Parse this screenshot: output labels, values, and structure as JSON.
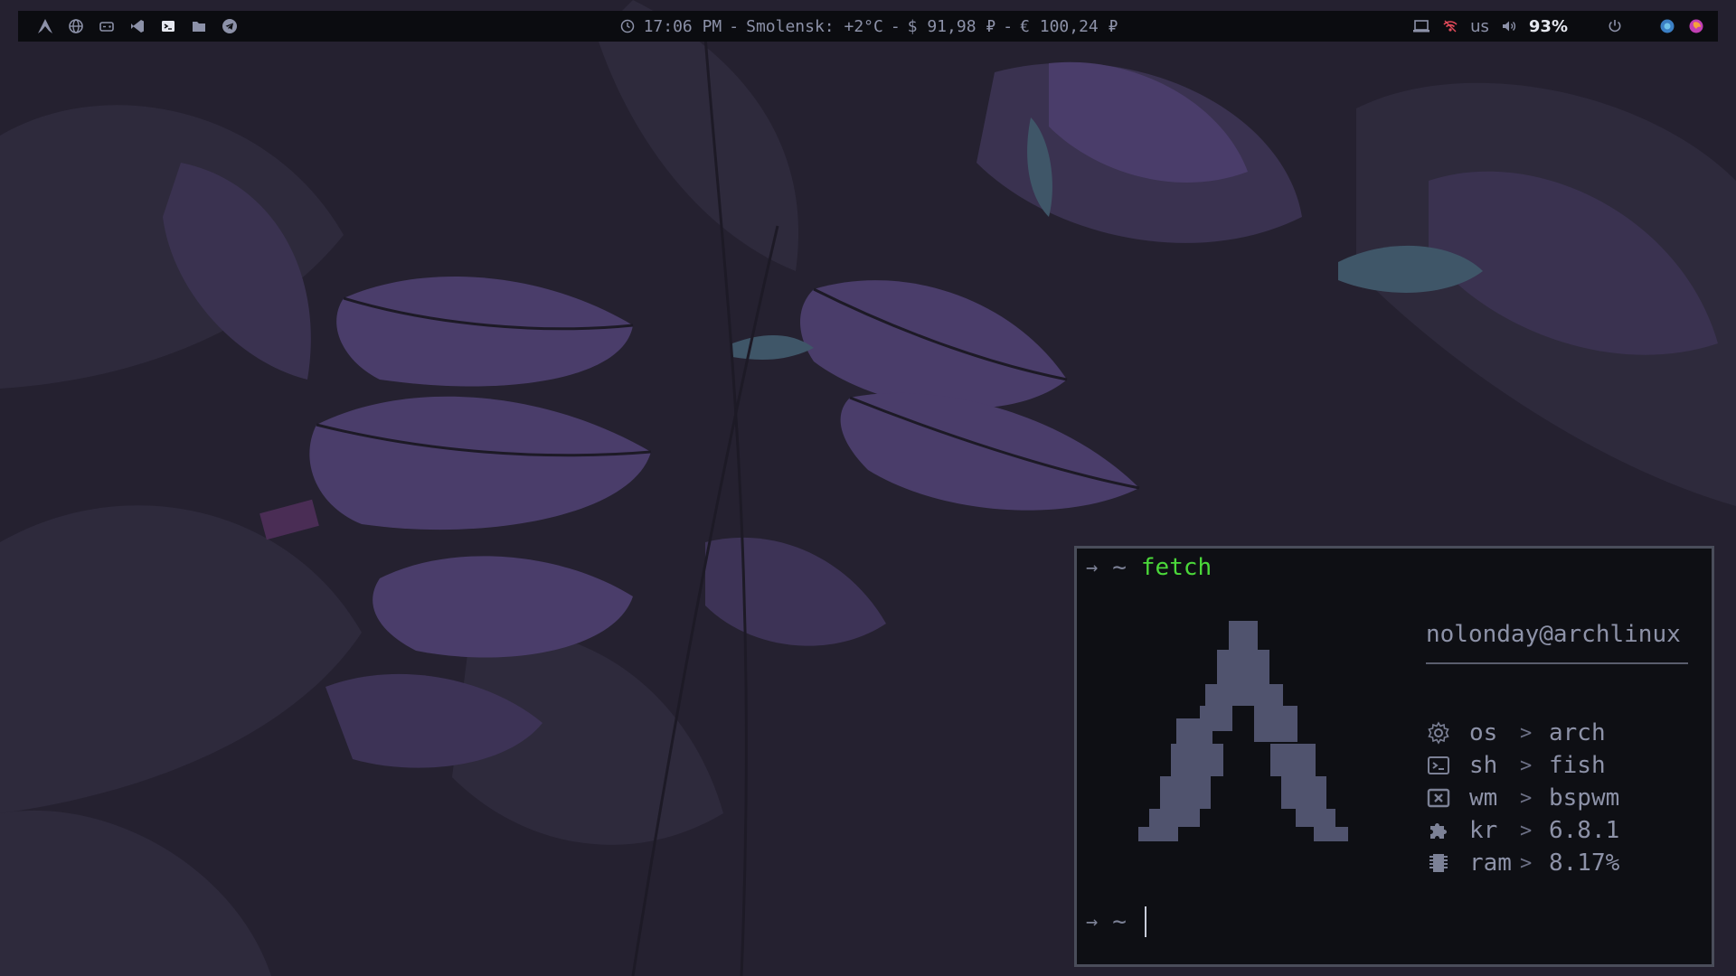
{
  "topbar": {
    "left_icons": [
      "arch-logo-icon",
      "globe-icon",
      "gamepad-icon",
      "vscode-icon",
      "terminal-icon",
      "folder-icon",
      "telegram-icon"
    ],
    "clock": "17:06 PM",
    "dash1": "-",
    "weather": "Smolensk: +2°C",
    "dash2": "-",
    "usd": "$ 91,98 ₽",
    "dash3": "-",
    "eur": "€ 100,24 ₽",
    "lang": "us",
    "battery": "93%",
    "right_icons": [
      "laptop-icon",
      "wifi-off-icon",
      "volume-icon",
      "power-icon",
      "browser-icon",
      "firefox-icon"
    ]
  },
  "terminal": {
    "prompt_arrow": "→",
    "tilde": "~",
    "command": "fetch",
    "user_host": "nolonday@archlinux",
    "rows": [
      {
        "icon": "gear-icon",
        "key": "os",
        "sep": ">",
        "value": "arch"
      },
      {
        "icon": "terminal-box-icon",
        "key": "sh",
        "sep": ">",
        "value": "fish"
      },
      {
        "icon": "window-close-icon",
        "key": "wm",
        "sep": ">",
        "value": "bspwm"
      },
      {
        "icon": "puzzle-icon",
        "key": "kr",
        "sep": ">",
        "value": "6.8.1"
      },
      {
        "icon": "memory-icon",
        "key": "ram",
        "sep": ">",
        "value": "8.17%"
      }
    ]
  },
  "colors": {
    "bar_bg": "#0b0c10",
    "terminal_bg": "#0e0f14",
    "command_green": "#4bd83a",
    "logo": "#50536e",
    "wallpaper_purple": "#4a3d6a"
  }
}
